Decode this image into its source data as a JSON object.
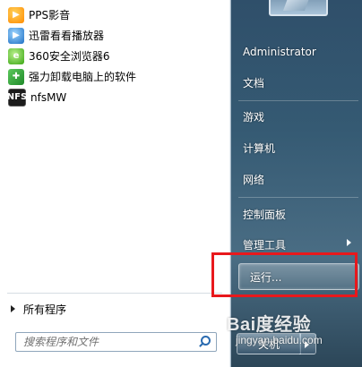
{
  "programs": [
    {
      "label": "PPS影音",
      "icon": "pps-icon"
    },
    {
      "label": "迅雷看看播放器",
      "icon": "xunlei-player-icon"
    },
    {
      "label": "360安全浏览器6",
      "icon": "browser-360-icon"
    },
    {
      "label": "强力卸载电脑上的软件",
      "icon": "uninstall-icon"
    },
    {
      "label": "nfsMW",
      "icon": "nfsmw-icon"
    }
  ],
  "all_programs_label": "所有程序",
  "search": {
    "placeholder": "搜索程序和文件"
  },
  "right_menu": {
    "user": "Administrator",
    "documents": "文档",
    "games": "游戏",
    "computer": "计算机",
    "network": "网络",
    "control_panel": "控制面板",
    "admin_tools": "管理工具",
    "run": "运行..."
  },
  "shutdown_label": "关机",
  "watermark": {
    "brand": "Bai度经验",
    "site": "jingyan.baidu.com"
  },
  "colors": {
    "highlight": "#e8181c",
    "panel": "#ffffff"
  }
}
